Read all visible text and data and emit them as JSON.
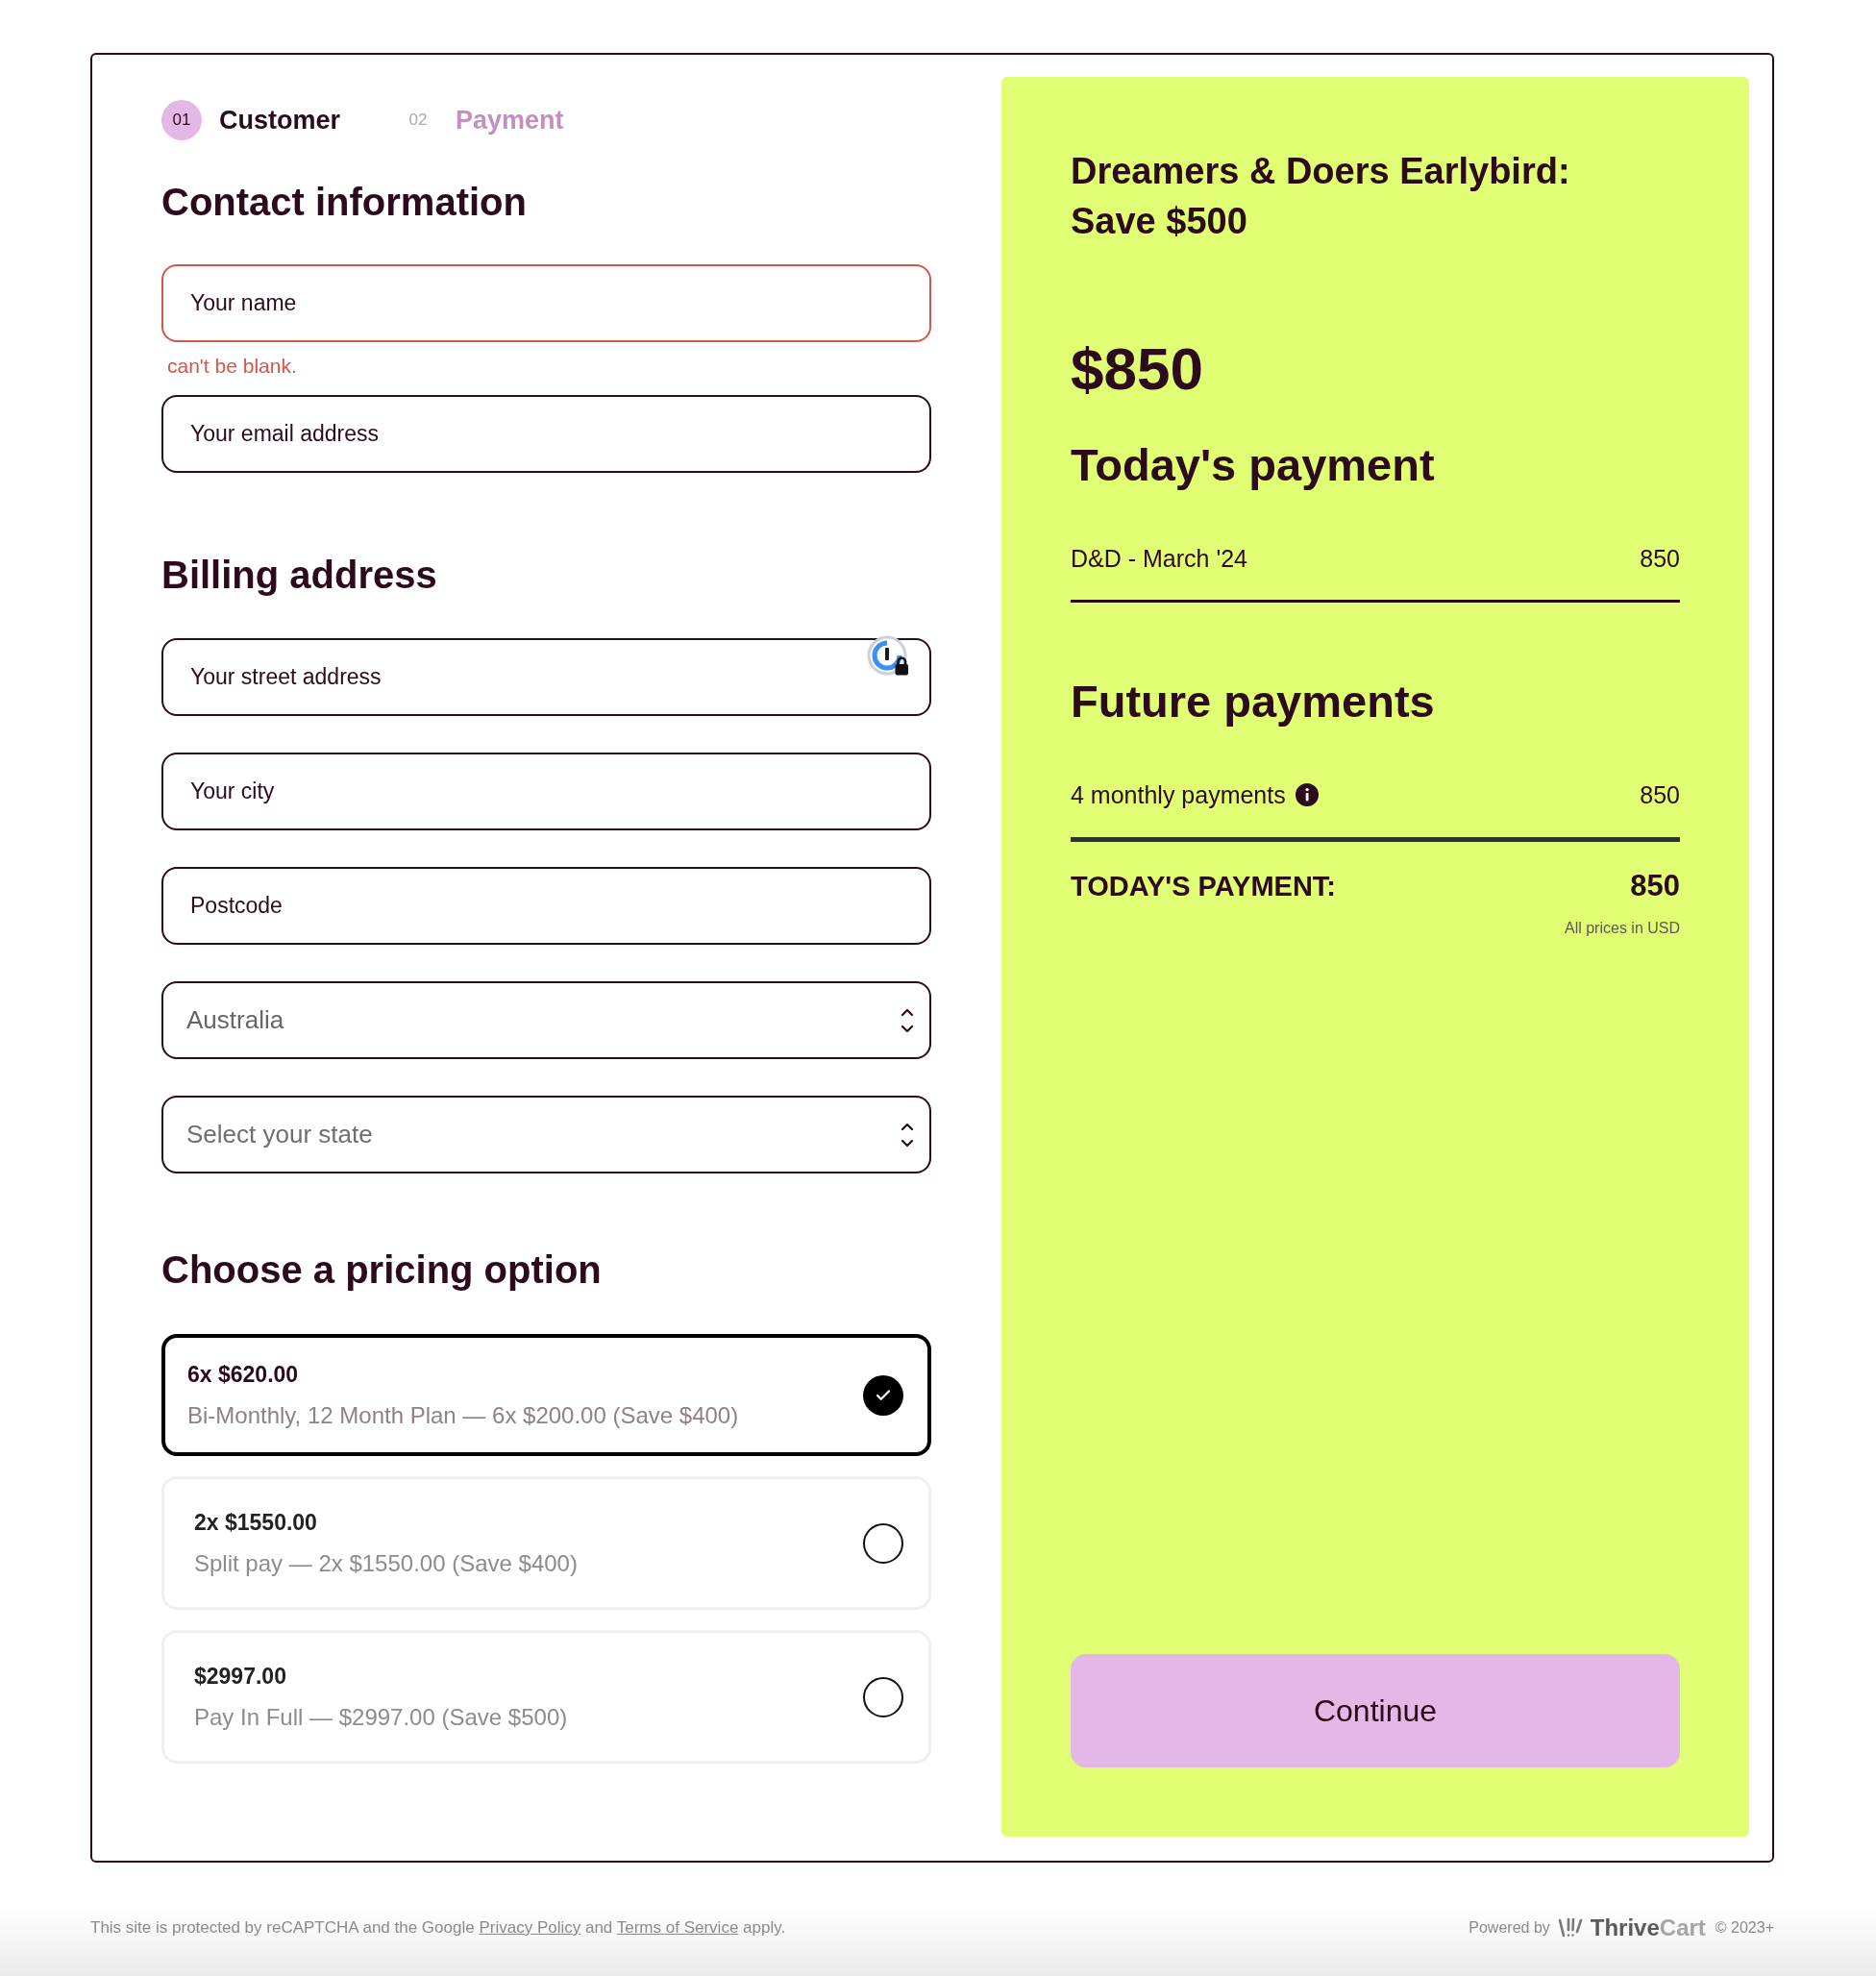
{
  "steps": [
    {
      "number": "01",
      "label": "Customer",
      "selected": true
    },
    {
      "number": "02",
      "label": "Payment",
      "selected": false
    }
  ],
  "contact": {
    "heading": "Contact information",
    "fields": [
      {
        "kind": "text",
        "placeholder": "Your name",
        "error": "can't be blank."
      },
      {
        "kind": "text",
        "placeholder": "Your email address"
      }
    ]
  },
  "billing": {
    "heading": "Billing address",
    "fields": [
      {
        "kind": "text",
        "placeholder": "Your street address",
        "autofill_badge": true
      },
      {
        "kind": "text",
        "placeholder": "Your city"
      },
      {
        "kind": "text",
        "placeholder": "Postcode"
      },
      {
        "kind": "select",
        "value": "Australia"
      },
      {
        "kind": "select",
        "placeholder": "Select your state"
      }
    ]
  },
  "pricing": {
    "heading": "Choose a pricing option",
    "options": [
      {
        "title": "6x $620.00",
        "description": "Bi-Monthly, 12 Month Plan — 6x $200.00 (Save $400)",
        "selected": true
      },
      {
        "title": "2x $1550.00",
        "description": "Split pay — 2x $1550.00 (Save $400)",
        "selected": false
      },
      {
        "title": "$2997.00",
        "description": "Pay In Full — $2997.00 (Save $500)",
        "selected": false
      }
    ]
  },
  "summary": {
    "title": "Dreamers & Doers Earlybird: Save $500",
    "price": "$850",
    "sections": [
      {
        "heading": "Today's payment",
        "rows": [
          {
            "label": "D&D - March '24",
            "amount": "850"
          }
        ]
      },
      {
        "heading": "Future payments",
        "rows": [
          {
            "label": "4 monthly payments",
            "amount": "850",
            "info": true
          }
        ]
      }
    ],
    "total": {
      "label": "TODAY'S PAYMENT:",
      "amount": "850"
    },
    "note": "All prices in USD",
    "button": "Continue"
  },
  "footer": {
    "notice": [
      {
        "kind": "text",
        "text": "This site is protected by reCAPTCHA and the Google "
      },
      {
        "kind": "link",
        "text": "Privacy Policy"
      },
      {
        "kind": "text",
        "text": " and "
      },
      {
        "kind": "link",
        "text": "Terms of Service"
      },
      {
        "kind": "text",
        "text": " apply."
      }
    ],
    "powered_by": "Powered by",
    "brand": {
      "primary": "Thrive",
      "secondary": "Cart"
    },
    "copyright": "© 2023+"
  }
}
